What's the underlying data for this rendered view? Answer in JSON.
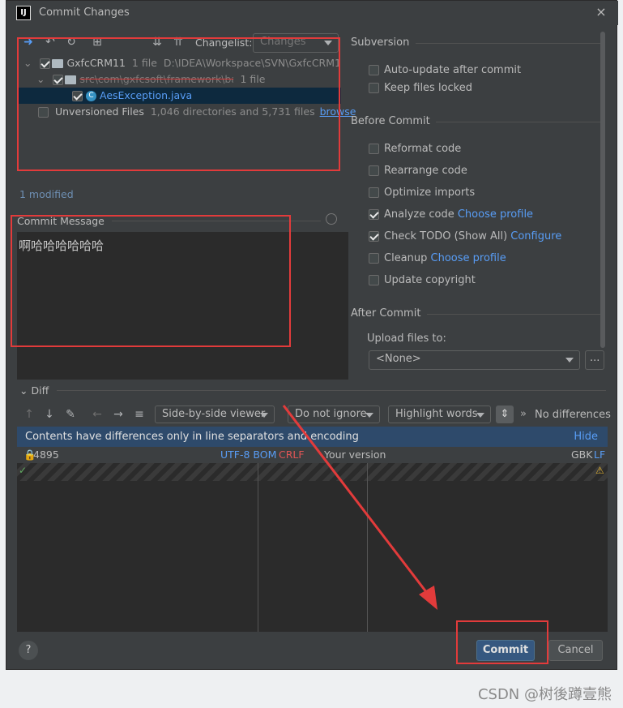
{
  "window": {
    "title": "Commit Changes",
    "close_icon": "×"
  },
  "toolbar": {
    "changelist_label": "Changelist:",
    "changelist_value": "Changes"
  },
  "tree": {
    "root_name": "GxfcCRM11",
    "root_count": "1 file",
    "root_path": "D:\\IDEA\\Workspace\\SVN\\GxfcCRM1",
    "pkg_name": "src\\com\\gxfcsoft\\framework\\base\\gxfcig\\aes",
    "pkg_count": "1 file",
    "file_name": "AesException.java",
    "unversioned_label": "Unversioned Files",
    "unversioned_info": "1,046 directories and 5,731 files",
    "browse": "browse"
  },
  "status": {
    "modified": "1 modified"
  },
  "message": {
    "label": "Commit Message",
    "text": "啊哈哈哈哈哈哈"
  },
  "subversion": {
    "header": "Subversion",
    "auto_update": "Auto-update after commit",
    "keep_locked": "Keep files locked"
  },
  "before": {
    "header": "Before Commit",
    "reformat": "Reformat code",
    "rearrange": "Rearrange code",
    "optimize": "Optimize imports",
    "analyze": "Analyze code",
    "analyze_link": "Choose profile",
    "todo": "Check TODO (Show All)",
    "todo_link": "Configure",
    "cleanup": "Cleanup",
    "cleanup_link": "Choose profile",
    "copyright": "Update copyright"
  },
  "after": {
    "header": "After Commit",
    "upload_label": "Upload files to:",
    "upload_value": "<None>",
    "more": "..."
  },
  "diff": {
    "header": "Diff",
    "viewer": "Side-by-side viewer",
    "ignore": "Do not ignore",
    "highlight": "Highlight words",
    "no_diff": "No differences",
    "notice": "Contents have differences only in line separators and encoding",
    "hide": "Hide",
    "left_rev": "4895",
    "left_enc": "UTF-8 BOM",
    "left_sep": "CRLF",
    "right_title": "Your version",
    "right_enc": "GBK",
    "right_sep": "LF"
  },
  "buttons": {
    "help": "?",
    "commit": "Commit",
    "cancel": "Cancel"
  },
  "watermark": "CSDN @树後蹲壹熊",
  "colors": {
    "accent": "#589df6",
    "dialog_bg": "#3c3f41",
    "commit_bg": "#365880",
    "annotation": "#e23b3b"
  }
}
